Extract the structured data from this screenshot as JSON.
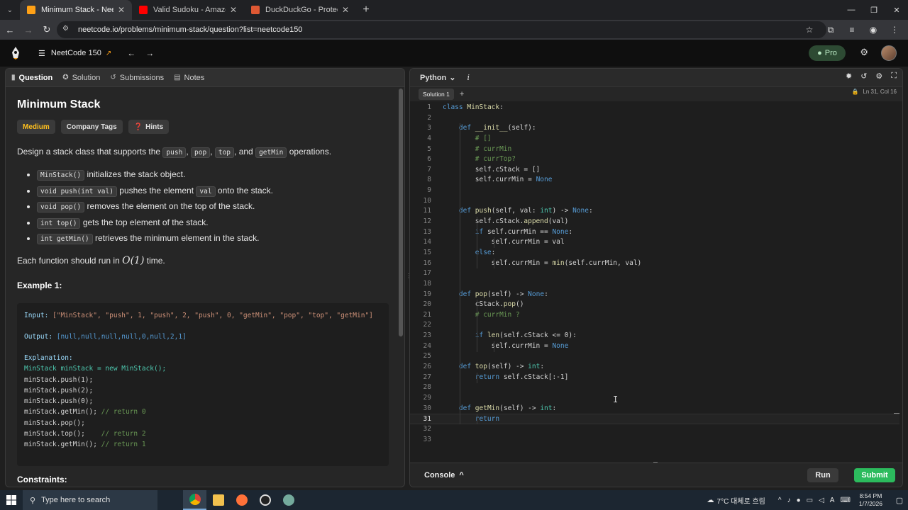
{
  "browser": {
    "tabs": [
      {
        "title": "Minimum Stack - NeetCode",
        "active": true,
        "favicon_color": "#ffa116"
      },
      {
        "title": "Valid Sudoku - Amazon Intervie",
        "active": false,
        "favicon_color": "#ff0000"
      },
      {
        "title": "DuckDuckGo - Protection. Priva",
        "active": false,
        "favicon_color": "#de5833"
      }
    ],
    "url": "neetcode.io/problems/minimum-stack/question?list=neetcode150"
  },
  "site": {
    "list_name": "NeetCode 150",
    "pro_label": "Pro"
  },
  "left_tabs": [
    "Question",
    "Solution",
    "Submissions",
    "Notes"
  ],
  "problem": {
    "title": "Minimum Stack",
    "difficulty": "Medium",
    "company_tags": "Company Tags",
    "hints": "Hints",
    "desc_pre": "Design a stack class that supports the",
    "desc_ops": [
      "push",
      "pop",
      "top",
      "getMin"
    ],
    "desc_and": "and",
    "desc_post": "operations.",
    "ops": [
      {
        "code": "MinStack()",
        "text": "initializes the stack object."
      },
      {
        "code": "void push(int val)",
        "text_a": "pushes the element",
        "code2": "val",
        "text_b": "onto the stack."
      },
      {
        "code": "void pop()",
        "text": "removes the element on the top of the stack."
      },
      {
        "code": "int top()",
        "text": "gets the top element of the stack."
      },
      {
        "code": "int getMin()",
        "text": "retrieves the minimum element in the stack."
      }
    ],
    "complexity_pre": "Each function should run in",
    "complexity_math": "O(1)",
    "complexity_post": "time.",
    "example_title": "Example 1:",
    "example": {
      "input_label": "Input:",
      "input_value": "[\"MinStack\", \"push\", 1, \"push\", 2, \"push\", 0, \"getMin\", \"pop\", \"top\", \"getMin\"]",
      "output_label": "Output:",
      "output_value": "[null,null,null,null,0,null,2,1]",
      "explanation_label": "Explanation:",
      "lines": [
        {
          "code": "MinStack minStack = new MinStack();",
          "comment": ""
        },
        {
          "code": "minStack.push(1);",
          "comment": ""
        },
        {
          "code": "minStack.push(2);",
          "comment": ""
        },
        {
          "code": "minStack.push(0);",
          "comment": ""
        },
        {
          "code": "minStack.getMin(); ",
          "comment": "// return 0"
        },
        {
          "code": "minStack.pop();",
          "comment": ""
        },
        {
          "code": "minStack.top();    ",
          "comment": "// return 2"
        },
        {
          "code": "minStack.getMin(); ",
          "comment": "// return 1"
        }
      ]
    },
    "constraints_title": "Constraints:"
  },
  "editor": {
    "language": "Python",
    "solution_tab": "Solution 1",
    "cursor_pos": "Ln 31, Col 16",
    "current_line": 31,
    "code_lines": [
      "class MinStack:",
      "",
      "    def __init__(self):",
      "        # []",
      "        # currMin",
      "        # currTop?",
      "        self.cStack = []",
      "        self.currMin = None",
      "",
      "",
      "    def push(self, val: int) -> None:",
      "        self.cStack.append(val)",
      "        if self.currMin == None:",
      "            self.currMin = val",
      "        else:",
      "            self.currMin = min(self.currMin, val)",
      "",
      "",
      "    def pop(self) -> None:",
      "        cStack.pop()",
      "        # currMin ?",
      "",
      "        if len(self.cStack <= 0):",
      "            self.currMin = None",
      "",
      "    def top(self) -> int:",
      "        return self.cStack[:-1]",
      "",
      "",
      "    def getMin(self) -> int:",
      "        return",
      "",
      ""
    ],
    "console_label": "Console",
    "run_label": "Run",
    "submit_label": "Submit"
  },
  "taskbar": {
    "search_placeholder": "Type here to search",
    "weather": "7°C  대체로 흐림",
    "time": "8:54 PM",
    "date": "1/7/2026"
  }
}
